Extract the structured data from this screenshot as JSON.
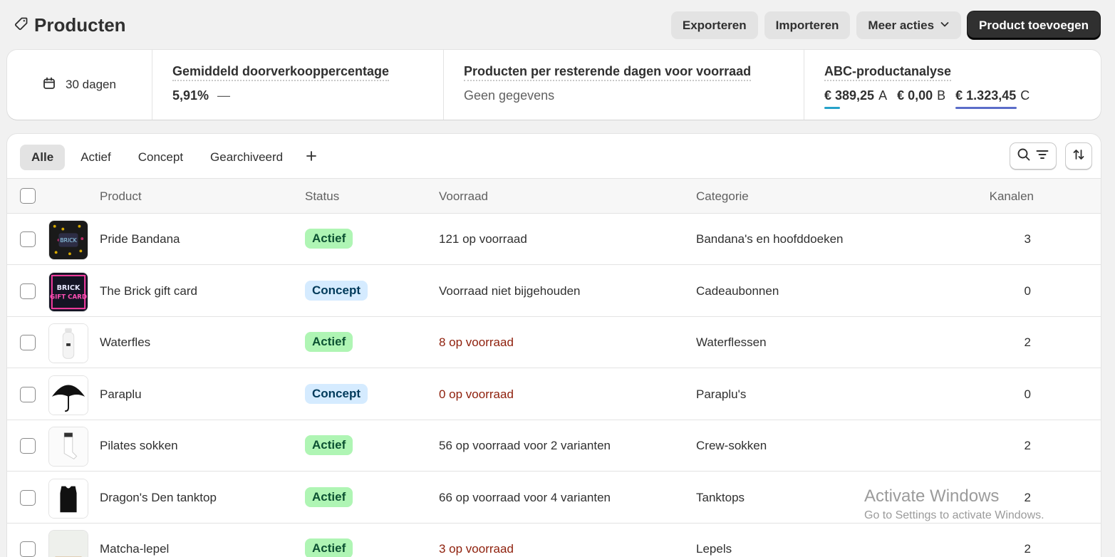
{
  "header": {
    "title": "Producten",
    "actions": {
      "export": "Exporteren",
      "import": "Importeren",
      "more": "Meer acties",
      "add": "Product toevoegen"
    }
  },
  "stats": {
    "period": "30 dagen",
    "sell_through": {
      "label": "Gemiddeld doorverkooppercentage",
      "value": "5,91%",
      "trend": "—"
    },
    "days_of_stock": {
      "label": "Producten per resterende dagen voor voorraad",
      "value": "Geen gegevens"
    },
    "abc": {
      "label": "ABC-productanalyse",
      "items": [
        {
          "value": "€ 389,25",
          "grade": "A",
          "color": "#26a2c9"
        },
        {
          "value": "€ 0,00",
          "grade": "B",
          "color": "#ffffff"
        },
        {
          "value": "€ 1.323,45",
          "grade": "C",
          "color": "#5b6dc9"
        }
      ]
    }
  },
  "tabs": [
    "Alle",
    "Actief",
    "Concept",
    "Gearchiveerd"
  ],
  "table": {
    "columns": {
      "product": "Product",
      "status": "Status",
      "stock": "Voorraad",
      "category": "Categorie",
      "channels": "Kanalen"
    },
    "rows": [
      {
        "product": "Pride Bandana",
        "status": "Actief",
        "stock": "121 op voorraad",
        "low": false,
        "category": "Bandana's en hoofddoeken",
        "channels": "3",
        "thumb": "bandana"
      },
      {
        "product": "The Brick gift card",
        "status": "Concept",
        "stock": "Voorraad niet bijgehouden",
        "low": false,
        "category": "Cadeaubonnen",
        "channels": "0",
        "thumb": "giftcard"
      },
      {
        "product": "Waterfles",
        "status": "Actief",
        "stock": "8 op voorraad",
        "low": true,
        "category": "Waterflessen",
        "channels": "2",
        "thumb": "bottle"
      },
      {
        "product": "Paraplu",
        "status": "Concept",
        "stock": "0 op voorraad",
        "low": true,
        "category": "Paraplu's",
        "channels": "0",
        "thumb": "umbrella"
      },
      {
        "product": "Pilates sokken",
        "status": "Actief",
        "stock": "56 op voorraad voor 2 varianten",
        "low": false,
        "category": "Crew-sokken",
        "channels": "2",
        "thumb": "socks"
      },
      {
        "product": "Dragon's Den tanktop",
        "status": "Actief",
        "stock": "66 op voorraad voor 4 varianten",
        "low": false,
        "category": "Tanktops",
        "channels": "2",
        "thumb": "tanktop"
      },
      {
        "product": "Matcha-lepel",
        "status": "Actief",
        "stock": "3 op voorraad",
        "low": true,
        "category": "Lepels",
        "channels": "2",
        "thumb": "spoon"
      }
    ]
  },
  "watermark": {
    "title": "Activate Windows",
    "subtitle": "Go to Settings to activate Windows."
  },
  "colors": {
    "active_badge": "#aff5b4",
    "concept_badge": "#d5ebff",
    "low_stock": "#8e1f0b",
    "primary_button": "#303030"
  },
  "icons": [
    "tag-icon",
    "chevron-down-icon",
    "calendar-icon",
    "plus-icon",
    "search-icon",
    "filter-icon",
    "sort-icon"
  ]
}
